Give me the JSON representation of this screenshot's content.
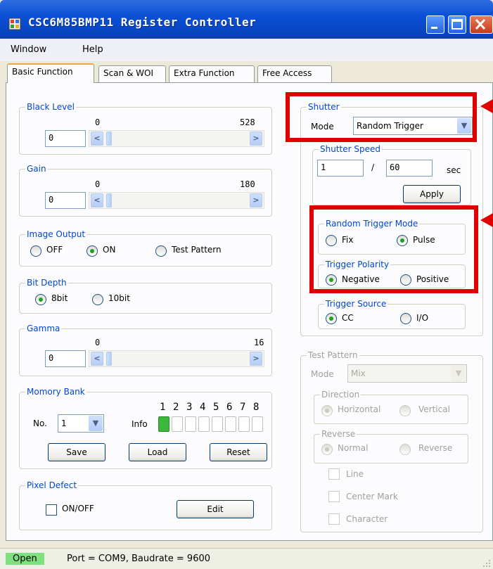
{
  "window": {
    "title": "CSC6M85BMP11 Register Controller"
  },
  "menu": [
    "Window",
    "Help"
  ],
  "tabs": [
    "Basic Function",
    "Scan & WOI",
    "Extra Function",
    "Free Access"
  ],
  "black_level": {
    "label": "Black Level",
    "min": "0",
    "max": "528",
    "value": "0",
    "level": 0.0
  },
  "gain": {
    "label": "Gain",
    "min": "0",
    "max": "180",
    "value": "0",
    "level": 0.0
  },
  "image_output": {
    "label": "Image Output",
    "options": [
      "OFF",
      "ON",
      "Test Pattern"
    ],
    "selected": "ON"
  },
  "bit_depth": {
    "label": "Bit Depth",
    "options": [
      "8bit",
      "10bit"
    ],
    "selected": "8bit"
  },
  "gamma": {
    "label": "Gamma",
    "min": "0",
    "max": "16",
    "value": "0",
    "level": 0.0
  },
  "memory_bank": {
    "label": "Momory Bank",
    "no_label": "No.",
    "no_value": "1",
    "info_label": "Info",
    "slots": [
      "1",
      "2",
      "3",
      "4",
      "5",
      "6",
      "7",
      "8"
    ],
    "active_slot": 1,
    "save": "Save",
    "load": "Load",
    "reset": "Reset"
  },
  "pixel_defect": {
    "label": "Pixel Defect",
    "checkbox": "ON/OFF",
    "edit": "Edit"
  },
  "shutter": {
    "label": "Shutter",
    "mode_label": "Mode",
    "mode_value": "Random Trigger"
  },
  "shutter_speed": {
    "label": "Shutter Speed",
    "numerator": "1",
    "slash": "/",
    "denominator": "60",
    "unit": "sec",
    "apply": "Apply"
  },
  "random_trigger_mode": {
    "label": "Random Trigger Mode",
    "options": [
      "Fix",
      "Pulse"
    ],
    "selected": "Pulse"
  },
  "trigger_polarity": {
    "label": "Trigger Polarity",
    "options": [
      "Negative",
      "Positive"
    ],
    "selected": "Negative"
  },
  "trigger_source": {
    "label": "Trigger Source",
    "options": [
      "CC",
      "I/O"
    ],
    "selected": "CC"
  },
  "test_pattern": {
    "label": "Test Pattern",
    "mode_label": "Mode",
    "mode_value": "Mix",
    "direction": {
      "label": "Direction",
      "options": [
        "Horizontal",
        "Vertical"
      ],
      "selected": "Horizontal"
    },
    "reverse": {
      "label": "Reverse",
      "options": [
        "Normal",
        "Reverse"
      ],
      "selected": "Normal"
    },
    "checks": [
      "Line",
      "Center Mark",
      "Character"
    ]
  },
  "status": {
    "state": "Open",
    "port_text": "Port = COM9,  Baudrate = 9600"
  },
  "colors": {
    "titlebar": "#0a4fd6",
    "group_label": "#0046d5",
    "highlight": "#e00000",
    "status_open": "#7fe07f"
  }
}
